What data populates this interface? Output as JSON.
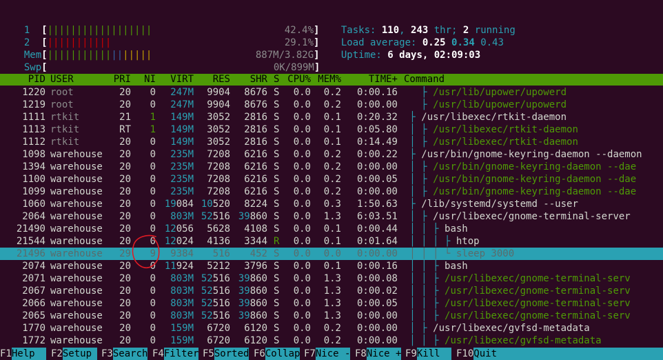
{
  "meters": {
    "cpu1": {
      "label": "1",
      "bars": "||||||||||||||||||",
      "value": "42.4%"
    },
    "cpu2": {
      "label": "2",
      "bars": "|||||||||||",
      "value": "29.1%"
    },
    "mem": {
      "label": "Mem",
      "bars": "||||||||||||||||||",
      "value": "887M/3.82G"
    },
    "swp": {
      "label": "Swp",
      "bars": "",
      "value": "0K/899M"
    }
  },
  "stats": {
    "tasks_label": "Tasks: ",
    "tasks": "110",
    "threads": "243",
    "thr_label": " thr; ",
    "running": "2",
    "running_label": " running",
    "load_label": "Load average: ",
    "load1": "0.25",
    "load5": "0.34",
    "load15": "0.43",
    "uptime_label": "Uptime: ",
    "uptime": "6 days, 02:09:03"
  },
  "columns": [
    "PID",
    "USER",
    "PRI",
    "NI",
    "VIRT",
    "RES",
    "SHR",
    "S",
    "CPU%",
    "MEM%",
    "TIME+",
    "Command"
  ],
  "processes": [
    {
      "pid": "1220",
      "user": "root",
      "pri": "20",
      "ni": "0",
      "virt": "247M",
      "res": "9904",
      "shr": "8676",
      "s": "S",
      "cpu": "0.0",
      "mem": "0.2",
      "time": "0:00.16",
      "tree": "   ├ ",
      "cmd": "/usr/lib/upower/upowerd",
      "thread": true
    },
    {
      "pid": "1219",
      "user": "root",
      "pri": "20",
      "ni": "0",
      "virt": "247M",
      "res": "9904",
      "shr": "8676",
      "s": "S",
      "cpu": "0.0",
      "mem": "0.2",
      "time": "0:00.00",
      "tree": "   ├ ",
      "cmd": "/usr/lib/upower/upowerd",
      "thread": true
    },
    {
      "pid": "1111",
      "user": "rtkit",
      "pri": "21",
      "ni": "1",
      "virt": "149M",
      "res": "3052",
      "shr": "2816",
      "s": "S",
      "cpu": "0.0",
      "mem": "0.1",
      "time": "0:20.32",
      "tree": " ├ ",
      "cmd": "/usr/libexec/rtkit-daemon",
      "thread": false
    },
    {
      "pid": "1113",
      "user": "rtkit",
      "pri": "RT",
      "ni": "1",
      "virt": "149M",
      "res": "3052",
      "shr": "2816",
      "s": "S",
      "cpu": "0.0",
      "mem": "0.1",
      "time": "0:05.80",
      "tree": " │ ├ ",
      "cmd": "/usr/libexec/rtkit-daemon",
      "thread": true
    },
    {
      "pid": "1112",
      "user": "rtkit",
      "pri": "20",
      "ni": "0",
      "virt": "149M",
      "res": "3052",
      "shr": "2816",
      "s": "S",
      "cpu": "0.0",
      "mem": "0.1",
      "time": "0:14.49",
      "tree": " │ ├ ",
      "cmd": "/usr/libexec/rtkit-daemon",
      "thread": true
    },
    {
      "pid": "1098",
      "user": "warehouse",
      "pri": "20",
      "ni": "0",
      "virt": "235M",
      "res": "7208",
      "shr": "6216",
      "s": "S",
      "cpu": "0.0",
      "mem": "0.2",
      "time": "0:00.22",
      "tree": " ├ ",
      "cmd": "/usr/bin/gnome-keyring-daemon --daemon",
      "thread": false
    },
    {
      "pid": "1394",
      "user": "warehouse",
      "pri": "20",
      "ni": "0",
      "virt": "235M",
      "res": "7208",
      "shr": "6216",
      "s": "S",
      "cpu": "0.0",
      "mem": "0.2",
      "time": "0:00.00",
      "tree": " │ ├ ",
      "cmd": "/usr/bin/gnome-keyring-daemon --dae",
      "thread": true
    },
    {
      "pid": "1100",
      "user": "warehouse",
      "pri": "20",
      "ni": "0",
      "virt": "235M",
      "res": "7208",
      "shr": "6216",
      "s": "S",
      "cpu": "0.0",
      "mem": "0.2",
      "time": "0:00.05",
      "tree": " │ ├ ",
      "cmd": "/usr/bin/gnome-keyring-daemon --dae",
      "thread": true
    },
    {
      "pid": "1099",
      "user": "warehouse",
      "pri": "20",
      "ni": "0",
      "virt": "235M",
      "res": "7208",
      "shr": "6216",
      "s": "S",
      "cpu": "0.0",
      "mem": "0.2",
      "time": "0:00.00",
      "tree": " │ ├ ",
      "cmd": "/usr/bin/gnome-keyring-daemon --dae",
      "thread": true
    },
    {
      "pid": "1060",
      "user": "warehouse",
      "pri": "20",
      "ni": "0",
      "virt": "19084",
      "res": "10520",
      "shr": "8224",
      "s": "S",
      "cpu": "0.0",
      "mem": "0.3",
      "time": "1:50.63",
      "tree": " ├ ",
      "cmd": "/lib/systemd/systemd --user",
      "thread": false
    },
    {
      "pid": "2064",
      "user": "warehouse",
      "pri": "20",
      "ni": "0",
      "virt": "803M",
      "res": "52516",
      "shr": "39860",
      "s": "S",
      "cpu": "0.0",
      "mem": "1.3",
      "time": "6:03.51",
      "tree": " │ ├ ",
      "cmd": "/usr/libexec/gnome-terminal-server",
      "thread": false
    },
    {
      "pid": "21490",
      "user": "warehouse",
      "pri": "20",
      "ni": "0",
      "virt": "12056",
      "res": "5628",
      "shr": "4108",
      "s": "S",
      "cpu": "0.0",
      "mem": "0.1",
      "time": "0:00.44",
      "tree": " │ │ ├ ",
      "cmd": "bash",
      "thread": false
    },
    {
      "pid": "21544",
      "user": "warehouse",
      "pri": "20",
      "ni": "0",
      "virt": "12024",
      "res": "4136",
      "shr": "3344",
      "s": "R",
      "cpu": "0.0",
      "mem": "0.1",
      "time": "0:01.64",
      "tree": " │ │ │ ├ ",
      "cmd": "htop",
      "thread": false
    },
    {
      "pid": "21496",
      "user": "warehouse",
      "pri": "29",
      "ni": "9",
      "virt": "9384",
      "res": "516",
      "shr": "452",
      "s": "S",
      "cpu": "0.0",
      "mem": "0.0",
      "time": "0:00.00",
      "tree": " │ │ │ └ ",
      "cmd": "sleep 3000",
      "thread": false,
      "selected": true
    },
    {
      "pid": "2074",
      "user": "warehouse",
      "pri": "20",
      "ni": "0",
      "virt": "11924",
      "res": "5212",
      "shr": "3796",
      "s": "S",
      "cpu": "0.0",
      "mem": "0.1",
      "time": "0:00.16",
      "tree": " │ │ ├ ",
      "cmd": "bash",
      "thread": false
    },
    {
      "pid": "2071",
      "user": "warehouse",
      "pri": "20",
      "ni": "0",
      "virt": "803M",
      "res": "52516",
      "shr": "39860",
      "s": "S",
      "cpu": "0.0",
      "mem": "1.3",
      "time": "0:00.08",
      "tree": " │ │ ├ ",
      "cmd": "/usr/libexec/gnome-terminal-serv",
      "thread": true
    },
    {
      "pid": "2067",
      "user": "warehouse",
      "pri": "20",
      "ni": "0",
      "virt": "803M",
      "res": "52516",
      "shr": "39860",
      "s": "S",
      "cpu": "0.0",
      "mem": "1.3",
      "time": "0:00.02",
      "tree": " │ │ ├ ",
      "cmd": "/usr/libexec/gnome-terminal-serv",
      "thread": true
    },
    {
      "pid": "2066",
      "user": "warehouse",
      "pri": "20",
      "ni": "0",
      "virt": "803M",
      "res": "52516",
      "shr": "39860",
      "s": "S",
      "cpu": "0.0",
      "mem": "1.3",
      "time": "0:00.05",
      "tree": " │ │ ├ ",
      "cmd": "/usr/libexec/gnome-terminal-serv",
      "thread": true
    },
    {
      "pid": "2065",
      "user": "warehouse",
      "pri": "20",
      "ni": "0",
      "virt": "803M",
      "res": "52516",
      "shr": "39860",
      "s": "S",
      "cpu": "0.0",
      "mem": "1.3",
      "time": "0:00.00",
      "tree": " │ │ ├ ",
      "cmd": "/usr/libexec/gnome-terminal-serv",
      "thread": true
    },
    {
      "pid": "1770",
      "user": "warehouse",
      "pri": "20",
      "ni": "0",
      "virt": "159M",
      "res": "6720",
      "shr": "6120",
      "s": "S",
      "cpu": "0.0",
      "mem": "0.2",
      "time": "0:00.00",
      "tree": " │ ├ ",
      "cmd": "/usr/libexec/gvfsd-metadata",
      "thread": false
    },
    {
      "pid": "1772",
      "user": "warehouse",
      "pri": "20",
      "ni": "0",
      "virt": "159M",
      "res": "6720",
      "shr": "6120",
      "s": "S",
      "cpu": "0.0",
      "mem": "0.2",
      "time": "0:00.00",
      "tree": " │ │ ├ ",
      "cmd": "/usr/libexec/gvfsd-metadata",
      "thread": true
    }
  ],
  "function_keys": [
    {
      "key": "F1",
      "label": "Help  "
    },
    {
      "key": "F2",
      "label": "Setup "
    },
    {
      "key": "F3",
      "label": "Search"
    },
    {
      "key": "F4",
      "label": "Filter"
    },
    {
      "key": "F5",
      "label": "Sorted"
    },
    {
      "key": "F6",
      "label": "Collap"
    },
    {
      "key": "F7",
      "label": "Nice -"
    },
    {
      "key": "F8",
      "label": "Nice +"
    },
    {
      "key": "F9",
      "label": "Kill  "
    },
    {
      "key": "F10",
      "label": "Quit"
    }
  ],
  "colors": {
    "background": "#2c0a22",
    "header_bar": "#4e9a06",
    "selection": "#2aa1b3",
    "annotation": "#e01b24"
  }
}
